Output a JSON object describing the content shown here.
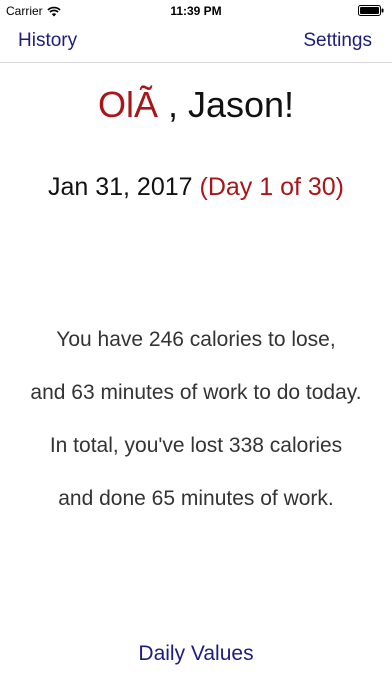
{
  "status_bar": {
    "carrier": "Carrier",
    "time": "11:39 PM",
    "wifi_icon": "wifi-icon",
    "battery_icon": "battery-icon"
  },
  "nav": {
    "left_label": "History",
    "right_label": "Settings"
  },
  "greeting": {
    "hello": "OlÃ",
    "rest": " , Jason!"
  },
  "date": {
    "text": "Jan 31, 2017",
    "day_count": "(Day 1 of 30)"
  },
  "summary": {
    "line1": "You have 246 calories to lose,",
    "line2": "and 63 minutes of work to do today.",
    "line3": "In total, you've lost 338 calories",
    "line4": "and done 65 minutes of work."
  },
  "footer": {
    "daily_values_label": "Daily Values"
  },
  "colors": {
    "accent_blue": "#1d1d7f",
    "accent_red": "#a8161a"
  }
}
